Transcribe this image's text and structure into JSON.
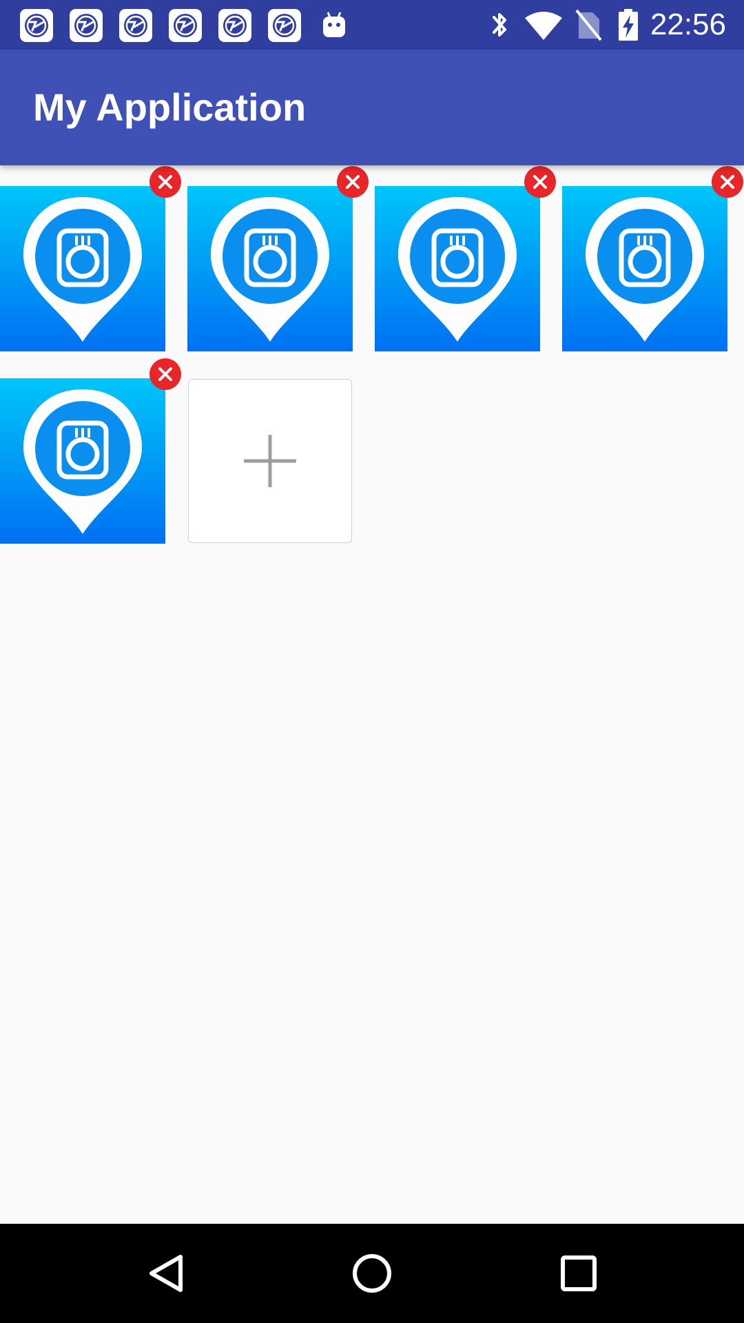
{
  "status_bar": {
    "time": "22:56",
    "notification_icons": [
      "app-notification-icon",
      "app-notification-icon",
      "app-notification-icon",
      "app-notification-icon",
      "app-notification-icon",
      "app-notification-icon",
      "android-debug-icon"
    ],
    "system_icons": [
      "bluetooth-icon",
      "wifi-icon",
      "no-sim-icon",
      "battery-charging-icon"
    ]
  },
  "app_bar": {
    "title": "My Application"
  },
  "photo_grid": {
    "items": [
      {
        "image": "camera-pin-icon",
        "remove": "remove-icon"
      },
      {
        "image": "camera-pin-icon",
        "remove": "remove-icon"
      },
      {
        "image": "camera-pin-icon",
        "remove": "remove-icon"
      },
      {
        "image": "camera-pin-icon",
        "remove": "remove-icon"
      },
      {
        "image": "camera-pin-icon",
        "remove": "remove-icon"
      }
    ],
    "add_button_icon": "plus-icon"
  },
  "nav_bar": {
    "buttons": [
      "back-icon",
      "home-icon",
      "recents-icon"
    ]
  },
  "colors": {
    "status_bar": "#303f9f",
    "app_bar": "#3f51b5",
    "background": "#fafafa",
    "tile_gradient_top": "#00c6f8",
    "tile_gradient_bottom": "#0070f2",
    "remove_badge": "#e8262a",
    "plus": "#9e9e9e"
  }
}
